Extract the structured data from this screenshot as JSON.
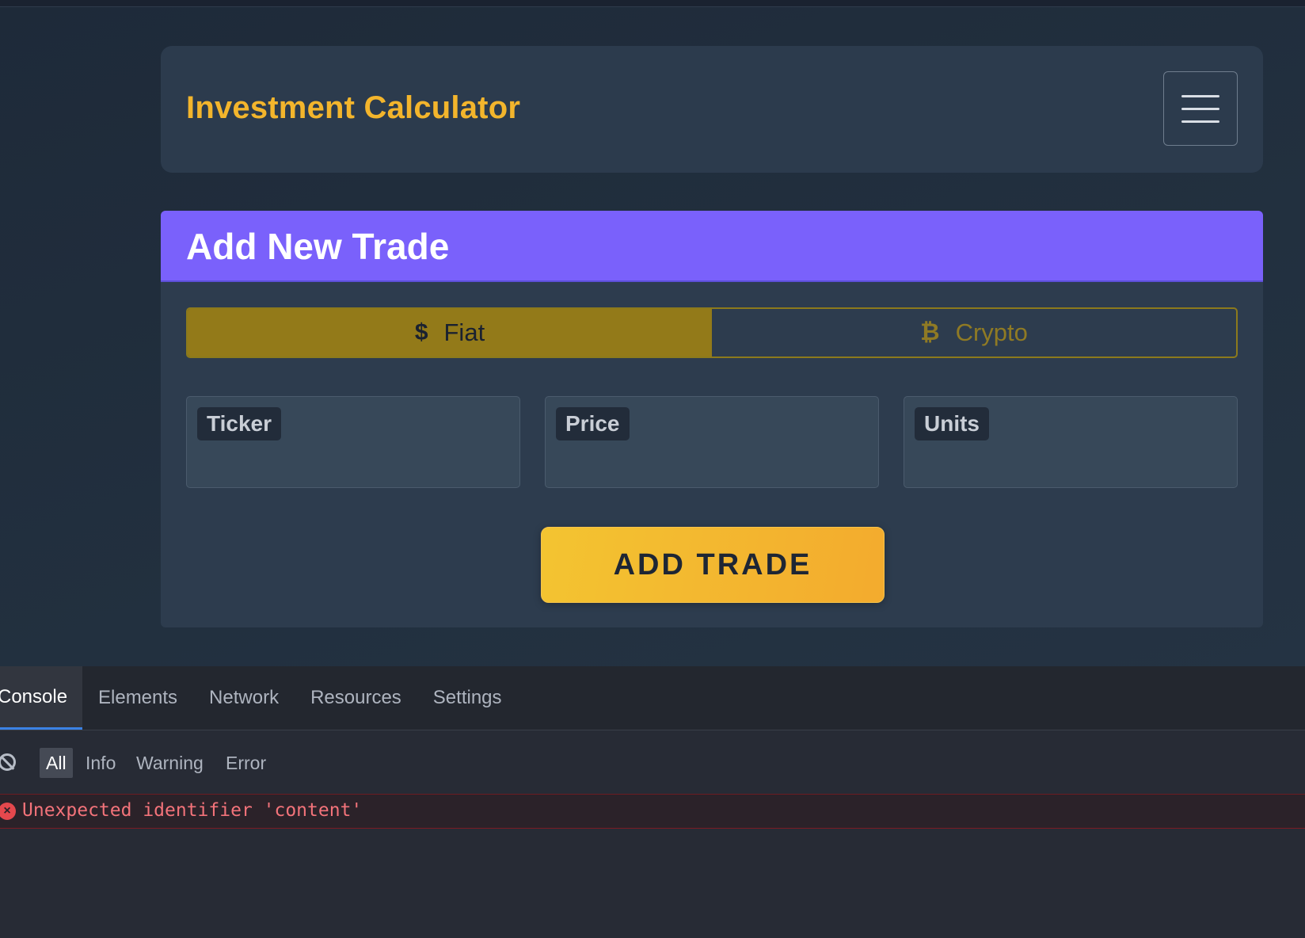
{
  "navbar": {
    "brand": "Investment Calculator",
    "menu_icon": "hamburger-menu-icon"
  },
  "trade_card": {
    "title": "Add New Trade",
    "asset_types": [
      {
        "symbol": "$",
        "label": "Fiat",
        "active": true
      },
      {
        "symbol": "₿",
        "label": "Crypto",
        "active": false
      }
    ],
    "fields": [
      {
        "label": "Ticker",
        "value": ""
      },
      {
        "label": "Price",
        "value": ""
      },
      {
        "label": "Units",
        "value": ""
      }
    ],
    "submit_label": "ADD TRADE"
  },
  "devtools": {
    "tabs": [
      "Console",
      "Elements",
      "Network",
      "Resources",
      "Settings"
    ],
    "active_tab": "Console",
    "filters": [
      "All",
      "Info",
      "Warning",
      "Error"
    ],
    "active_filter": "All",
    "logs": [
      {
        "level": "error",
        "message": "Unexpected identifier 'content'"
      }
    ]
  },
  "colors": {
    "brand": "#f3b52c",
    "card_header": "#7a61fb",
    "toggle_active": "#937a19",
    "submit_gradient_start": "#f3c431",
    "submit_gradient_end": "#f3ab2e",
    "error": "#e5484d"
  }
}
